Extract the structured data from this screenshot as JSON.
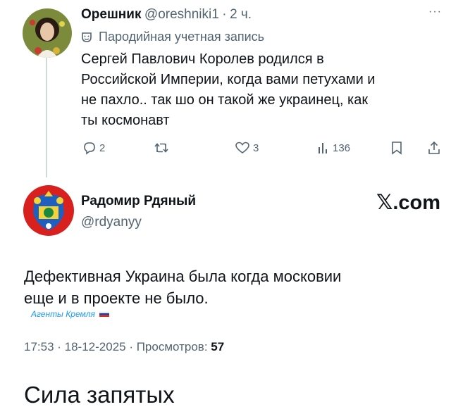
{
  "reply_tweet": {
    "author_name": "Орешник",
    "handle": "@oreshniki1",
    "separator": "·",
    "time": "2 ч.",
    "more_icon": "ellipsis-icon",
    "parody_label": "Пародийная учетная запись",
    "text_lines": [
      "Сергей Павлович Королев родился в",
      "Российской Империи, когда вами петухами и",
      "не пахло.. так шо он такой же украинец, как",
      "ты космонавт"
    ],
    "actions": {
      "reply_count": "2",
      "retweet_count": "",
      "like_count": "3",
      "views_count": "136"
    }
  },
  "main_tweet": {
    "author_name": "Радомир Рдяный",
    "handle": "@rdyanyy",
    "brand": "𝕏.com",
    "text_lines": [
      "Дефективная Украина была когда московии",
      "еще и в проекте не было."
    ],
    "watermark": "Агенты Кремля",
    "timestamp": "17:53 · 18-12-2025 · Просмотров:",
    "views": "57"
  },
  "caption": "Сила запятых",
  "colors": {
    "text": "#0f1419",
    "secondary": "#536471",
    "line": "#cfd9de",
    "watermark": "#1d9bf0"
  }
}
